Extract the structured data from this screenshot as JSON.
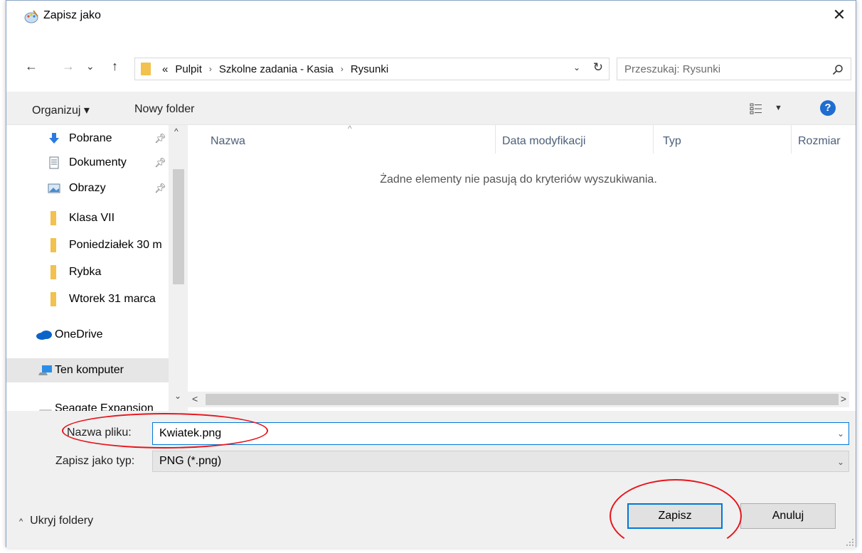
{
  "window": {
    "title": "Zapisz jako",
    "close_glyph": "✕"
  },
  "nav_buttons": {
    "back": "←",
    "forward": "→",
    "recent": "⌄",
    "up": "↑"
  },
  "address": {
    "prefix": "«",
    "crumbs": [
      "Pulpit",
      "Szkolne zadania - Kasia",
      "Rysunki"
    ],
    "separator": "›"
  },
  "search": {
    "placeholder": "Przeszukaj: Rysunki"
  },
  "toolbar": {
    "organize": "Organizuj ▾",
    "new_folder": "Nowy folder",
    "help": "?"
  },
  "nav_pane": {
    "items": [
      {
        "label": "Pobrane",
        "icon": "download-icon",
        "pinned": true
      },
      {
        "label": "Dokumenty",
        "icon": "document-icon",
        "pinned": true
      },
      {
        "label": "Obrazy",
        "icon": "pictures-icon",
        "pinned": true
      },
      {
        "label": "Klasa VII",
        "icon": "folder-icon",
        "pinned": false
      },
      {
        "label": "Poniedziałek 30 m",
        "icon": "folder-icon",
        "pinned": false
      },
      {
        "label": "Rybka",
        "icon": "folder-icon",
        "pinned": false
      },
      {
        "label": "Wtorek 31 marca",
        "icon": "folder-icon",
        "pinned": false
      },
      {
        "label": "OneDrive",
        "icon": "onedrive-icon",
        "pinned": false
      },
      {
        "label": "Ten komputer",
        "icon": "computer-icon",
        "pinned": false
      },
      {
        "label": "Seagate Expansion",
        "icon": "drive-icon",
        "pinned": false
      }
    ],
    "selected": "Ten komputer"
  },
  "file_list": {
    "columns": [
      "Nazwa",
      "Data modyfikacji",
      "Typ",
      "Rozmiar"
    ],
    "empty_message": "Żadne elementy nie pasują do kryteriów wyszukiwania."
  },
  "form": {
    "filename_label": "Nazwa pliku:",
    "filename_value": "Kwiatek.png",
    "type_label": "Zapisz jako typ:",
    "type_value": "PNG (*.png)"
  },
  "footer": {
    "hide_folders": "Ukryj foldery",
    "save": "Zapisz",
    "cancel": "Anuluj"
  },
  "colors": {
    "accent": "#0078d7",
    "annotation": "#e8141b",
    "folder": "#f2c14e"
  }
}
